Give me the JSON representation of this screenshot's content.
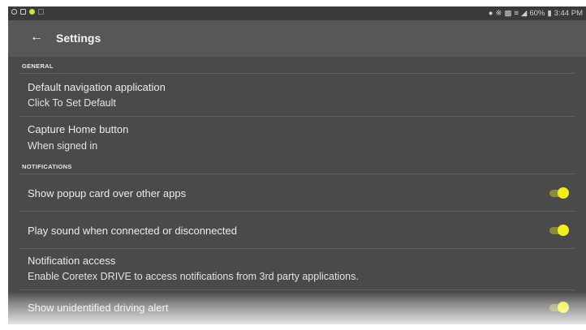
{
  "status_bar": {
    "left_icons": [
      "blocked-icon",
      "notification-icon",
      "status-dot-icon",
      "sim-icon"
    ],
    "right_icons": [
      "location-icon",
      "bluetooth-icon",
      "nfc-icon",
      "vibrate-icon",
      "signal-icon"
    ],
    "battery": "60%",
    "battery_icon": "battery-icon",
    "time": "3:44 PM"
  },
  "toolbar": {
    "back_icon": "arrow-left-icon",
    "title": "Settings"
  },
  "sections": {
    "general": {
      "header": "GENERAL",
      "items": [
        {
          "title": "Default navigation application",
          "summary": "Click To Set Default"
        },
        {
          "title": "Capture Home button",
          "summary": "When signed in"
        }
      ]
    },
    "notifications": {
      "header": "NOTIFICATIONS",
      "items": [
        {
          "title": "Show popup card over other apps",
          "toggle_on": true
        },
        {
          "title": "Play sound when connected or disconnected",
          "toggle_on": true
        },
        {
          "title": "Notification access",
          "summary": "Enable Coretex DRIVE to access notifications from 3rd party applications."
        },
        {
          "title": "Show unidentified driving alert",
          "toggle_on": true
        }
      ]
    }
  },
  "colors": {
    "background": "#4a4a4a",
    "toolbar": "#575757",
    "status_bar": "#3a3a3a",
    "switch_thumb": "#f0ee1f",
    "switch_track": "#8a8a3e",
    "text": "#ececec"
  }
}
